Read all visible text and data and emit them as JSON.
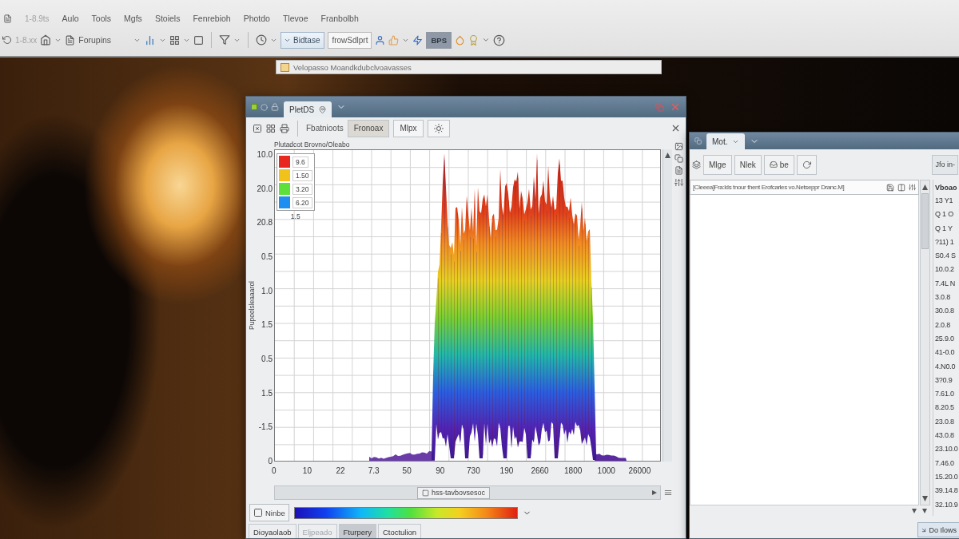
{
  "menu_bar": {
    "info": "1-8.9ts",
    "items": [
      "Aulo",
      "Tools",
      "Mgfs",
      "Stoiels",
      "Fenrebioh",
      "Photdo",
      "Tlevoe",
      "Franbolbh"
    ]
  },
  "toolbar": {
    "info": "1-8.xx",
    "layers_label": "Forupins",
    "dataset_select": "Bidtase",
    "mode_field": "frowSdlprt",
    "bps_button": {
      "label": "BPS",
      "pressed": true
    }
  },
  "status_tip": "Velopasso Moandkdubclvoavasses",
  "plot_window": {
    "tab": "PletDS",
    "toolbar_label": "Fbatnioots",
    "buttons": [
      {
        "label": "Fronoax",
        "selected": true
      },
      {
        "label": "Mlpx",
        "selected": false
      }
    ],
    "chart_title": "Plutadcot Brovno/Oleabo",
    "y_axis_title": "Pupoolsleaaarol",
    "y_ticks": [
      "10.0",
      "20.0",
      "20.8",
      "0.5",
      "1.0",
      "1.5",
      "0.5",
      "1.5",
      "-1.5",
      "0"
    ],
    "x_ticks": [
      "0",
      "10",
      "22",
      "7.3",
      "50",
      "90",
      "730",
      "190",
      "2660",
      "1800",
      "1000",
      "26000"
    ],
    "legend": {
      "items": [
        {
          "label": "9.6",
          "color": "#e8281e"
        },
        {
          "label": "1.50",
          "color": "#f2c21c"
        },
        {
          "label": "3.20",
          "color": "#5ee03a"
        },
        {
          "label": "6.20",
          "color": "#1e8ef0"
        }
      ],
      "footer": "1.5"
    },
    "scroll_thumb": "hss-tavbovsesoc",
    "colormap_label": "Ninbe",
    "tabs": [
      {
        "label": "Dioyaolaob",
        "selected": false,
        "disabled": false
      },
      {
        "label": "Eljpeado",
        "selected": false,
        "disabled": true
      },
      {
        "label": "Fturpery",
        "selected": true,
        "disabled": false
      },
      {
        "label": "Ctoctulion",
        "selected": false,
        "disabled": false
      }
    ]
  },
  "list_window": {
    "tab": "Mot.",
    "buttons": [
      "Mlge",
      "Nlek"
    ],
    "inbox_button": "be",
    "side_button": "Jfo in-",
    "header": "[Cleeea]Fra:lds tnour thent Erofcarles vo.Netseppr Dranc.M]",
    "column": {
      "title": "Vboao",
      "values": [
        "13 Y1",
        "Q 1 O",
        "Q 1 Y",
        "?11) 1",
        "S0.4 S",
        "10.0.2",
        "7.4L N",
        "3.0.8",
        "30.0.8",
        "2.0.8",
        "25.9.0",
        "41-0.0",
        "4.N0.0",
        "3?0.9",
        "7.61.0",
        "8.20.5",
        "23.0.8",
        "43.0.8",
        "23.10.0",
        "7.46.0",
        "15.20.0",
        "39.14.8",
        "32.10.9"
      ]
    },
    "footer_button": "Do Ilows"
  }
}
